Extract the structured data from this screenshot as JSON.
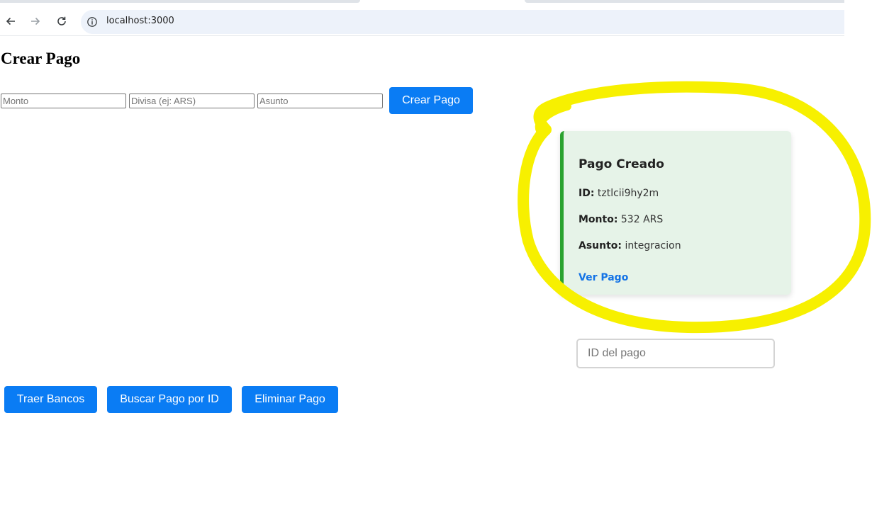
{
  "browser": {
    "url": "localhost:3000",
    "icons": {
      "back": "arrow-left-icon",
      "forward": "arrow-right-icon",
      "reload": "reload-icon",
      "site_info": "info-circle-icon"
    }
  },
  "page": {
    "title": "Crear Pago",
    "form": {
      "amount_placeholder": "Monto",
      "currency_placeholder": "Divisa (ej: ARS)",
      "subject_placeholder": "Asunto",
      "submit_label": "Crear Pago"
    },
    "result_card": {
      "title": "Pago Creado",
      "id_label": "ID:",
      "id_value": "tztlcii9hy2m",
      "amount_label": "Monto:",
      "amount_value": "532 ARS",
      "subject_label": "Asunto:",
      "subject_value": "integracion",
      "link_label": "Ver Pago",
      "accent_color": "#2aa22f",
      "background_color": "#e6f3e8"
    },
    "search": {
      "placeholder": "ID del pago"
    },
    "actions": {
      "banks_label": "Traer Bancos",
      "search_label": "Buscar Pago por ID",
      "delete_label": "Eliminar Pago"
    },
    "button_color": "#0a7cf4",
    "annotation_color": "#f7f000"
  }
}
